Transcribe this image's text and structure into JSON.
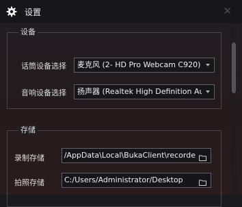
{
  "window": {
    "title": "设置"
  },
  "device_group": {
    "title": "设备",
    "mic_label": "话筒设备选择",
    "mic_value": "麦克风 (2- HD Pro Webcam C920)",
    "speaker_label": "音响设备选择",
    "speaker_value": "扬声器 (Realtek High Definition Audio)"
  },
  "storage_group": {
    "title": "存储",
    "record_label": "录制存储",
    "record_path": "C:/Users/Administrator/AppData\\Local\\BukaClient\\recorde",
    "photo_label": "拍照存储",
    "photo_path": "C:/Users/Administrator/Desktop"
  },
  "icons": {
    "settings": "gear-icon",
    "close": "close-icon",
    "dropdown": "chevron-down-icon",
    "browse": "folder-icon"
  },
  "colors": {
    "background": "#1b1a1f",
    "border": "#47444c",
    "scrollbar": "#55525b"
  }
}
